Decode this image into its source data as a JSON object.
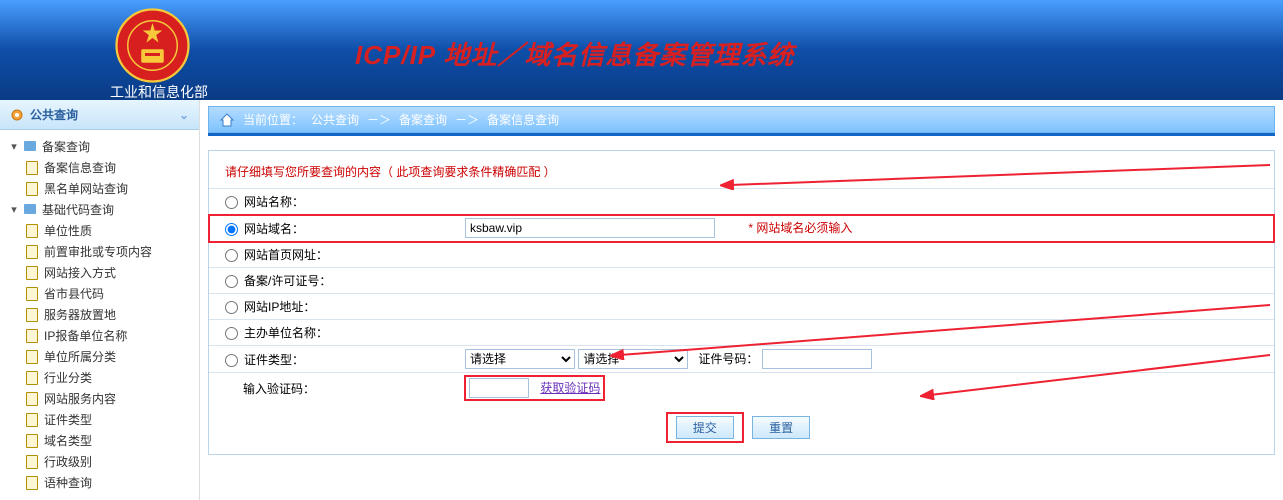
{
  "header": {
    "org": "工业和信息化部",
    "system_title": "ICP/IP 地址／域名信息备案管理系统"
  },
  "sidebar": {
    "section": "公共查询",
    "groups": [
      {
        "label": "备案查询",
        "children": [
          "备案信息查询",
          "黑名单网站查询"
        ]
      },
      {
        "label": "基础代码查询",
        "children": [
          "单位性质",
          "前置审批或专项内容",
          "网站接入方式",
          "省市县代码",
          "服务器放置地",
          "IP报备单位名称",
          "单位所属分类",
          "行业分类",
          "网站服务内容",
          "证件类型",
          "域名类型",
          "行政级别",
          "语种查询"
        ]
      }
    ]
  },
  "breadcrumb": {
    "loc_label": "当前位置：",
    "a": "公共查询",
    "sep": "－＞",
    "b": "备案查询",
    "c": "备案信息查询"
  },
  "form": {
    "title": "请仔细填写您所要查询的内容（ 此项查询要求条件精确匹配 ）",
    "rows": {
      "site_name": "网站名称：",
      "site_domain": "网站域名：",
      "home_url": "网站首页网址：",
      "license": "备案/许可证号：",
      "ip": "网站IP地址：",
      "sponsor": "主办单位名称：",
      "cert_type": "证件类型：",
      "captcha": "输入验证码："
    },
    "domain_value": "ksbaw.vip",
    "domain_note": "* 网站域名必须输入",
    "select_placeholder": "请选择",
    "cert_no_label": "证件号码：",
    "captcha_link": "获取验证码",
    "submit": "提交",
    "reset": "重置"
  }
}
